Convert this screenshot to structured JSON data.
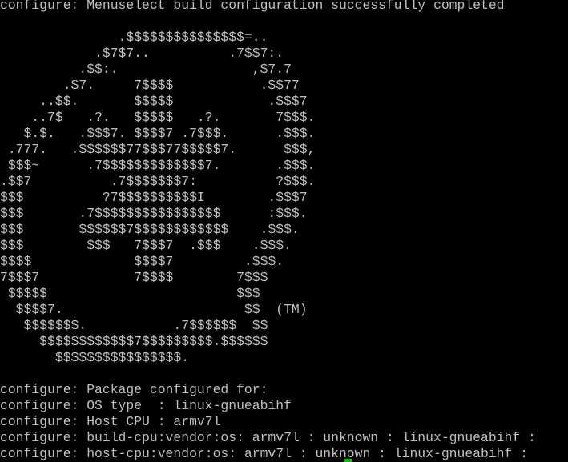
{
  "colors": {
    "background": "#000000",
    "foreground": "#c0c0c0",
    "cursor": "#00c000"
  },
  "terminal": {
    "lines": [
      "configure: Menuselect build configuration successfully completed",
      "",
      "               .$$$$$$$$$$$$$$$=..",
      "            .$7$7..          .7$$7:.",
      "          .$$:.                 ,$7.7",
      "        .$7.     7$$$$           .$$77",
      "     ..$$.       $$$$$            .$$$7",
      "    ..7$   .?.   $$$$$   .?.       7$$$.",
      "   $.$.   .$$$7. $$$$7 .7$$$.      .$$$.",
      " .777.   .$$$$$$77$$$77$$$$$7.      $$$,",
      " $$$~      .7$$$$$$$$$$$$$7.       .$$$.",
      ".$$7          .7$$$$$$$7:          ?$$$.",
      "$$$          ?7$$$$$$$$$$I        .$$$7",
      "$$$       .7$$$$$$$$$$$$$$$$      :$$$.",
      "$$$       $$$$$$7$$$$$$$$$$$$    .$$$.",
      "$$$        $$$   7$$$7  .$$$    .$$$.",
      "$$$$             $$$$7         .$$$.",
      "7$$$7            7$$$$        7$$$",
      " $$$$$                        $$$",
      "  $$$$7.                       $$  (TM)",
      "   $$$$$$$.           .7$$$$$$  $$",
      "     $$$$$$$$$$$$7$$$$$$$$$.$$$$$$",
      "       $$$$$$$$$$$$$$$$.",
      "",
      "configure: Package configured for:",
      "configure: OS type  : linux-gnueabihf",
      "configure: Host CPU : armv7l",
      "configure: build-cpu:vendor:os: armv7l : unknown : linux-gnueabihf :",
      "configure: host-cpu:vendor:os: armv7l : unknown : linux-gnueabihf :"
    ]
  }
}
